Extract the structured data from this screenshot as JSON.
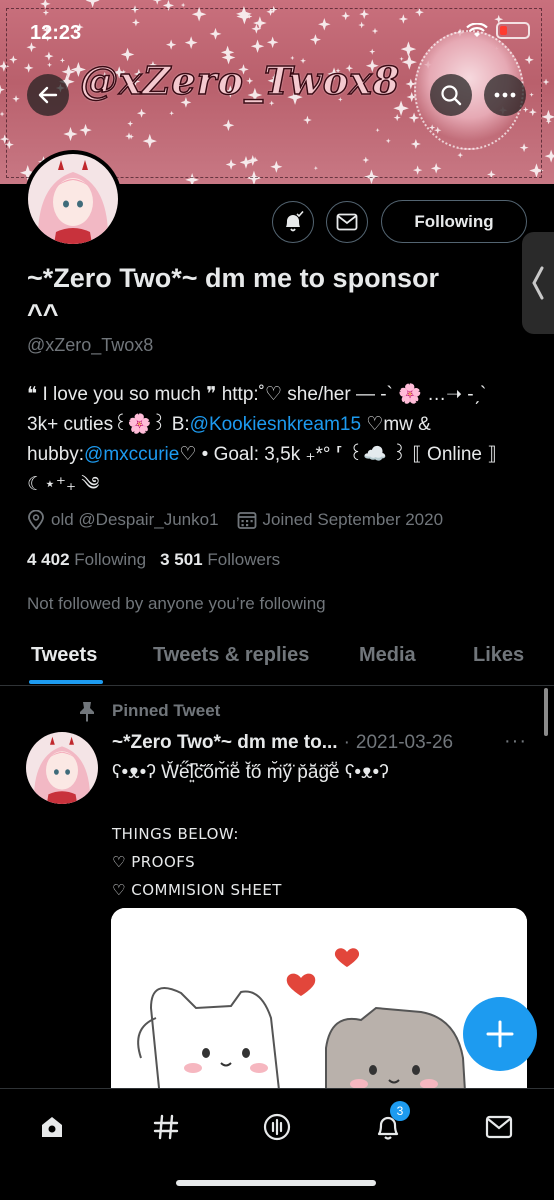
{
  "status_bar": {
    "time": "12:23"
  },
  "banner": {
    "title": "@xZero_Twox8"
  },
  "profile": {
    "display_name": "~*Zero Two*~ dm me to sponsor ^^",
    "handle": "@xZero_Twox8",
    "bio": {
      "part1": "❝ I love you so much ❞ http:˚♡ she/her — -` 🌸 …➝ -ˏ` 3k+ cuties꒰🌸꒱ B:",
      "mention1": "@Kookiesnkream15",
      "part2": " ♡mw & hubby:",
      "mention2": "@mxccurie",
      "part3": "♡ • Goal: 3,5k ₊*° ⸢ ꒰☁️ ꒱ ⟦ Online ⟧ ☾⋆⁺₊ ༄"
    },
    "location": "old @Despair_Junko1",
    "joined": "Joined September 2020",
    "following_count": "4 402",
    "following_label": "Following",
    "followers_count": "3 501",
    "followers_label": "Followers",
    "not_followed_text": "Not followed by anyone you’re following",
    "following_button": "Following"
  },
  "tabs": [
    {
      "label": "Tweets",
      "active": true
    },
    {
      "label": "Tweets & replies",
      "active": false
    },
    {
      "label": "Media",
      "active": false
    },
    {
      "label": "Likes",
      "active": false
    }
  ],
  "tweet": {
    "pinned_label": "Pinned Tweet",
    "author": "~*Zero Two*~ dm me to...",
    "separator": "·",
    "date": "2021-03-26",
    "more": "···",
    "text": "ʕ•ᴥ•ʔ W̆̈e̋͂l͍͆c̈̆őm̆̈ě̈ t̆̈ő m̆̈y̋̈ p̆ă̈g̈̆ě̈ ʕ•ᴥ•ʔ",
    "line1": "THINGS BELOW:",
    "line2": "♡ PROOFS",
    "line3": "♡ COMMISION SHEET"
  },
  "fab_label": "+",
  "nav": {
    "notification_badge": "3"
  },
  "colors": {
    "accent": "#1d9bf0",
    "muted": "#71767b",
    "background": "#000000",
    "banner": "#c9707d"
  }
}
